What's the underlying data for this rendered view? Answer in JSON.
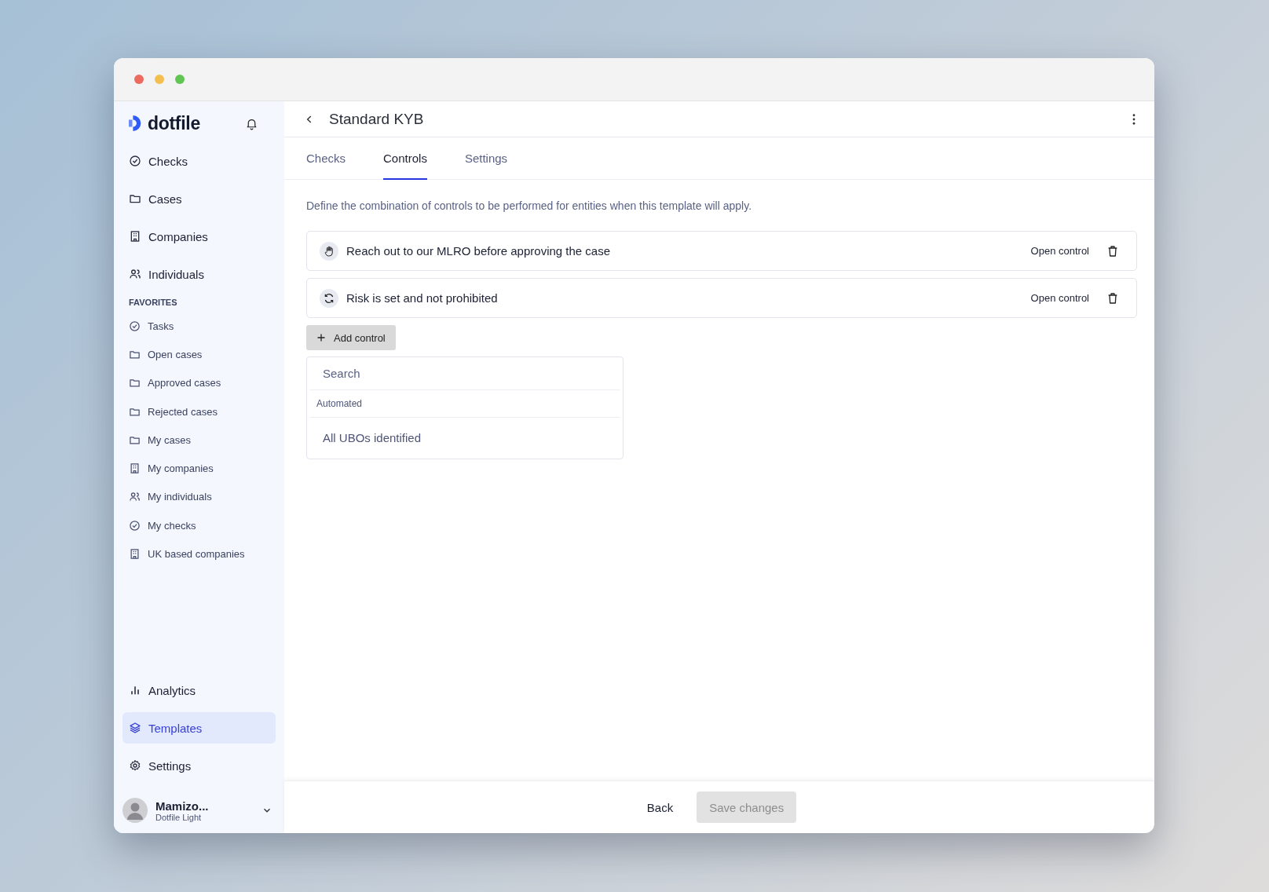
{
  "sidebar": {
    "logo": "dotfile",
    "nav": [
      {
        "label": "Checks",
        "kind": "check",
        "selected": false
      },
      {
        "label": "Cases",
        "kind": "folder",
        "selected": false
      },
      {
        "label": "Companies",
        "kind": "company",
        "selected": false
      },
      {
        "label": "Individuals",
        "kind": "people",
        "selected": false
      }
    ],
    "favorites_title": "FAVORITES",
    "favorites": [
      {
        "label": "Tasks",
        "kind": "check"
      },
      {
        "label": "Open cases",
        "kind": "folder"
      },
      {
        "label": "Approved cases",
        "kind": "folder"
      },
      {
        "label": "Rejected cases",
        "kind": "folder"
      },
      {
        "label": "My cases",
        "kind": "folder"
      },
      {
        "label": "My companies",
        "kind": "company"
      },
      {
        "label": "My individuals",
        "kind": "people"
      },
      {
        "label": "My checks",
        "kind": "check"
      },
      {
        "label": "UK based companies",
        "kind": "company"
      }
    ],
    "bottom_nav": [
      {
        "label": "Analytics",
        "kind": "chart",
        "selected": false
      },
      {
        "label": "Templates",
        "kind": "layers",
        "selected": true
      },
      {
        "label": "Settings",
        "kind": "gear",
        "selected": false
      }
    ],
    "user": {
      "name": "Mamizo...",
      "workspace": "Dotfile Light"
    }
  },
  "header": {
    "title": "Standard KYB"
  },
  "tabs": [
    {
      "label": "Checks",
      "selected": false
    },
    {
      "label": "Controls",
      "selected": true
    },
    {
      "label": "Settings",
      "selected": false
    }
  ],
  "description": "Define the combination of controls to be performed for entities when this template will apply.",
  "controls": [
    {
      "kind": "manual",
      "title": "Reach out to our MLRO before approving the case",
      "action": "Open control"
    },
    {
      "kind": "automated",
      "title": "Risk is set and not prohibited",
      "action": "Open control"
    }
  ],
  "add_control": {
    "label": "Add control"
  },
  "dropdown": {
    "placeholder": "Search",
    "group": "Automated",
    "options": [
      "All UBOs identified"
    ]
  },
  "footer": {
    "back": "Back",
    "save": {
      "label": "Save changes",
      "disabled": true
    }
  }
}
